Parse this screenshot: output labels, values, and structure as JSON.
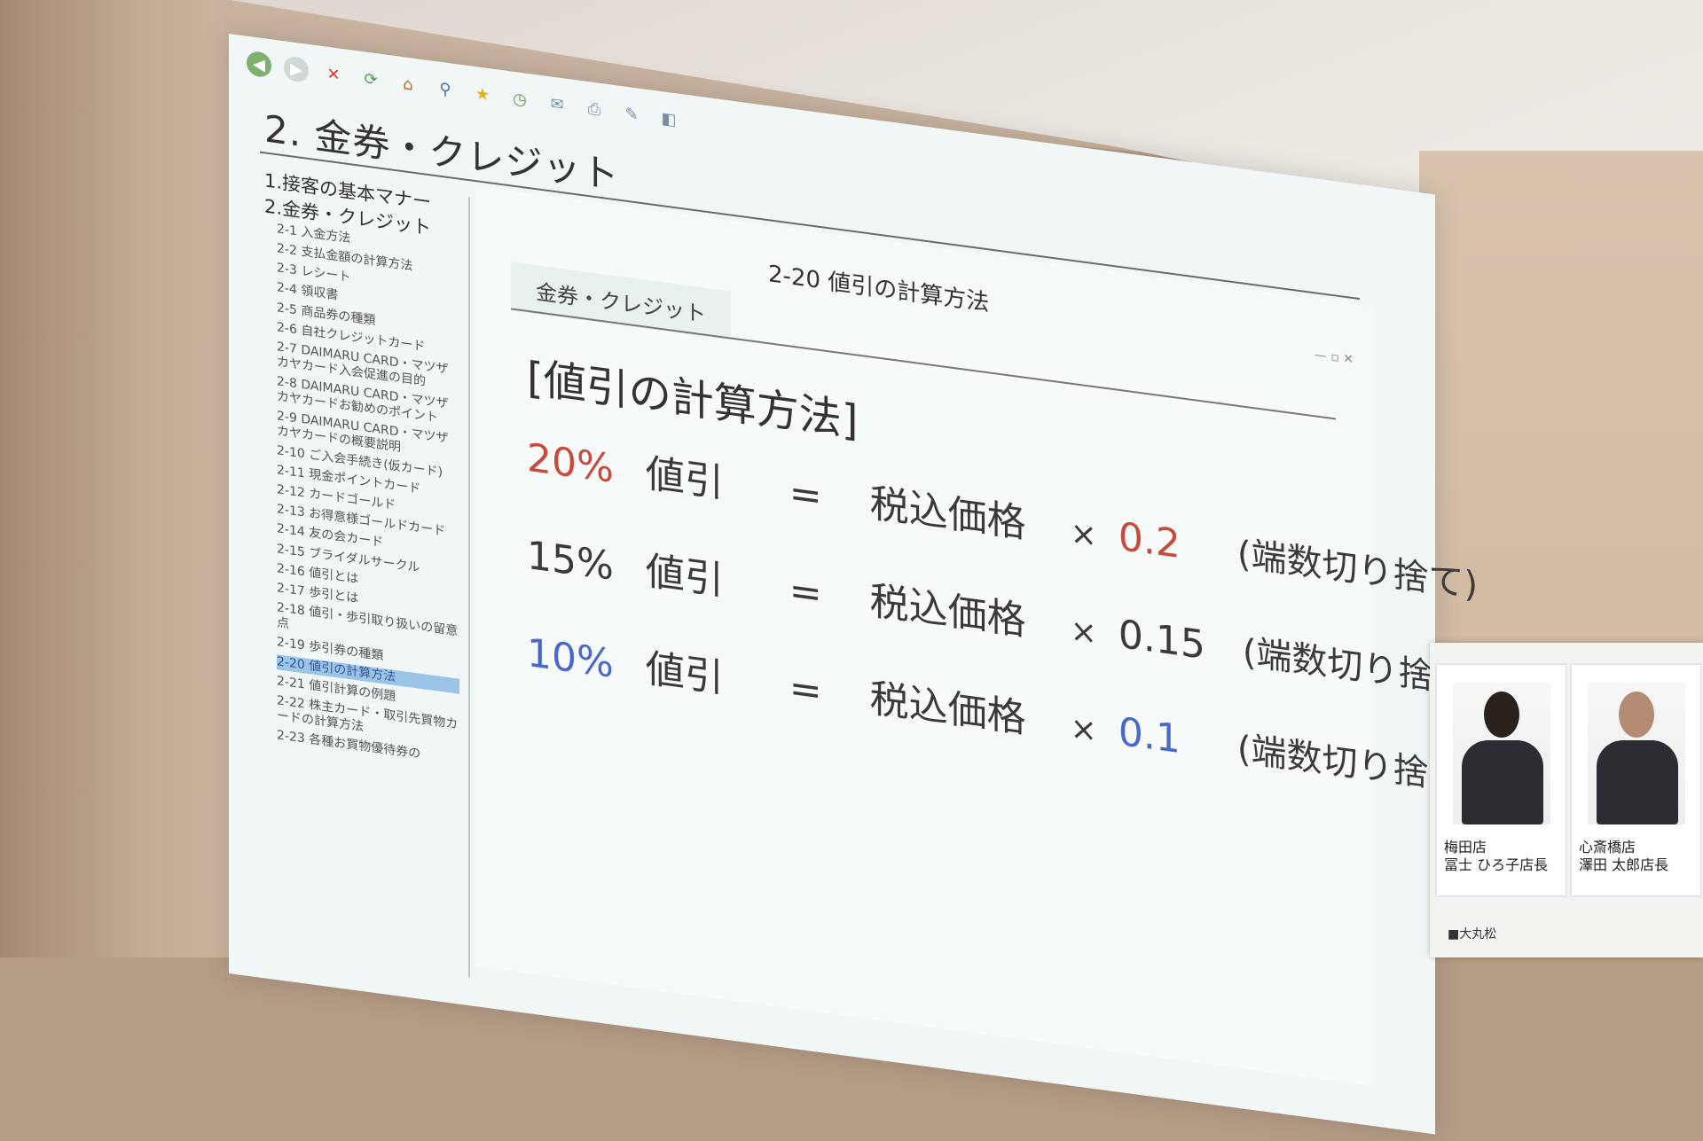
{
  "slide": {
    "title": "2. 金券・クレジット"
  },
  "sidebar": {
    "main_items": [
      "1.接客の基本マナー",
      "2.金券・クレジット"
    ],
    "sub_items": [
      "2-1 入金方法",
      "2-2 支払金額の計算方法",
      "2-3 レシート",
      "2-4 領収書",
      "2-5 商品券の種類",
      "2-6 自社クレジットカード",
      "2-7 DAIMARU CARD・マツザカヤカード入会促進の目的",
      "2-8 DAIMARU CARD・マツザカヤカードお勧めのポイント",
      "2-9 DAIMARU CARD・マツザカヤカードの概要説明",
      "2-10 ご入会手続き(仮カード)",
      "2-11 現金ポイントカード",
      "2-12 カードゴールド",
      "2-13 お得意様ゴールドカード",
      "2-14 友の会カード",
      "2-15 ブライダルサークル",
      "2-16 値引とは",
      "2-17 歩引とは",
      "2-18 値引・歩引取り扱いの留意点",
      "2-19 歩引券の種類",
      "2-20 値引の計算方法",
      "2-21 値引計算の例題",
      "2-22 株主カード・取引先買物カードの計算方法",
      "2-23 各種お買物優待券の"
    ],
    "active_index": 19
  },
  "content": {
    "title": "2-20 値引の計算方法",
    "tab": "金券・クレジット",
    "heading": "[値引の計算方法]",
    "equations": [
      {
        "percent": "20%",
        "label": "値引",
        "equals": "=",
        "base": "税込価格",
        "times": "×",
        "factor": "0.2",
        "note": "(端数切り捨て)",
        "color": "#c84a3b"
      },
      {
        "percent": "15%",
        "label": "値引",
        "equals": "=",
        "base": "税込価格",
        "times": "×",
        "factor": "0.15",
        "note": "(端数切り捨て)",
        "color": "#3a3a3a"
      },
      {
        "percent": "10%",
        "label": "値引",
        "equals": "=",
        "base": "税込価格",
        "times": "×",
        "factor": "0.1",
        "note": "(端数切り捨て)",
        "color": "#4a68c8"
      }
    ]
  },
  "posters": [
    {
      "store": "梅田店",
      "name": "冨士 ひろ子店長"
    },
    {
      "store": "心斎橋店",
      "name": "澤田 太郎店長"
    }
  ],
  "poster_footer": "■大丸松"
}
